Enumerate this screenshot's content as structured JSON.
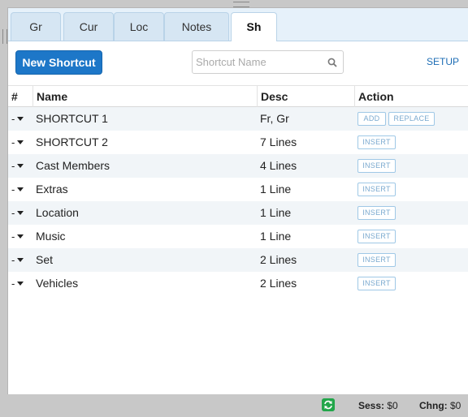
{
  "tabs": [
    "Gr",
    "Cur",
    "Loc",
    "Notes",
    "Sh"
  ],
  "active_tab": "Sh",
  "toolbar": {
    "new_label": "New Shortcut",
    "search_placeholder": "Shortcut Name",
    "setup_label": "SETUP"
  },
  "table": {
    "headers": {
      "index": "#",
      "name": "Name",
      "desc": "Desc",
      "action": "Action"
    },
    "rows": [
      {
        "index": "-",
        "name": "SHORTCUT 1",
        "desc": "Fr, Gr",
        "actions": [
          "ADD",
          "REPLACE"
        ]
      },
      {
        "index": "-",
        "name": "SHORTCUT 2",
        "desc": "7 Lines",
        "actions": [
          "INSERT"
        ]
      },
      {
        "index": "-",
        "name": "Cast Members",
        "desc": "4 Lines",
        "actions": [
          "INSERT"
        ]
      },
      {
        "index": "-",
        "name": "Extras",
        "desc": "1 Line",
        "actions": [
          "INSERT"
        ]
      },
      {
        "index": "-",
        "name": "Location",
        "desc": "1 Line",
        "actions": [
          "INSERT"
        ]
      },
      {
        "index": "-",
        "name": "Music",
        "desc": "1 Line",
        "actions": [
          "INSERT"
        ]
      },
      {
        "index": "-",
        "name": "Set",
        "desc": "2 Lines",
        "actions": [
          "INSERT"
        ]
      },
      {
        "index": "-",
        "name": "Vehicles",
        "desc": "2 Lines",
        "actions": [
          "INSERT"
        ]
      }
    ]
  },
  "status": {
    "sess_label": "Sess:",
    "sess_value": "$0",
    "chng_label": "Chng:",
    "chng_value": "$0"
  },
  "colors": {
    "accent": "#1d77c8",
    "tab_bg": "#d6e6f3",
    "row_alt": "#f1f5f8",
    "sync": "#22a64a"
  }
}
